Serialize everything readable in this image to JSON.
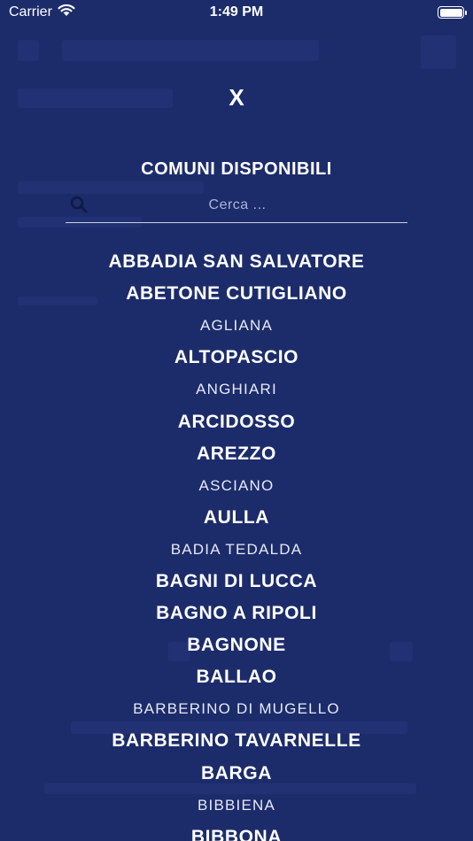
{
  "status_bar": {
    "carrier": "Carrier",
    "time": "1:49 PM",
    "wifi_icon": "wifi-icon",
    "battery_icon": "battery-icon"
  },
  "overlay": {
    "close_label": "X",
    "title": "COMUNI DISPONIBILI",
    "search": {
      "placeholder": "Cerca ...",
      "value": ""
    }
  },
  "comuni": [
    {
      "name": "ABBADIA SAN SALVATORE",
      "style": "bold"
    },
    {
      "name": "ABETONE CUTIGLIANO",
      "style": "bold"
    },
    {
      "name": "AGLIANA",
      "style": "light"
    },
    {
      "name": "ALTOPASCIO",
      "style": "bold"
    },
    {
      "name": "ANGHIARI",
      "style": "light"
    },
    {
      "name": "ARCIDOSSO",
      "style": "bold"
    },
    {
      "name": "AREZZO",
      "style": "bold"
    },
    {
      "name": "ASCIANO",
      "style": "light"
    },
    {
      "name": "AULLA",
      "style": "bold"
    },
    {
      "name": "BADIA TEDALDA",
      "style": "light"
    },
    {
      "name": "BAGNI DI LUCCA",
      "style": "bold"
    },
    {
      "name": "BAGNO A RIPOLI",
      "style": "bold"
    },
    {
      "name": "BAGNONE",
      "style": "bold"
    },
    {
      "name": "BALLAO",
      "style": "bold"
    },
    {
      "name": "BARBERINO DI MUGELLO",
      "style": "light"
    },
    {
      "name": "BARBERINO TAVARNELLE",
      "style": "bold"
    },
    {
      "name": "BARGA",
      "style": "bold"
    },
    {
      "name": "BIBBIENA",
      "style": "light"
    },
    {
      "name": "BIBBONA",
      "style": "bold"
    }
  ],
  "colors": {
    "background": "#1c2c6b",
    "text": "#ffffff"
  }
}
